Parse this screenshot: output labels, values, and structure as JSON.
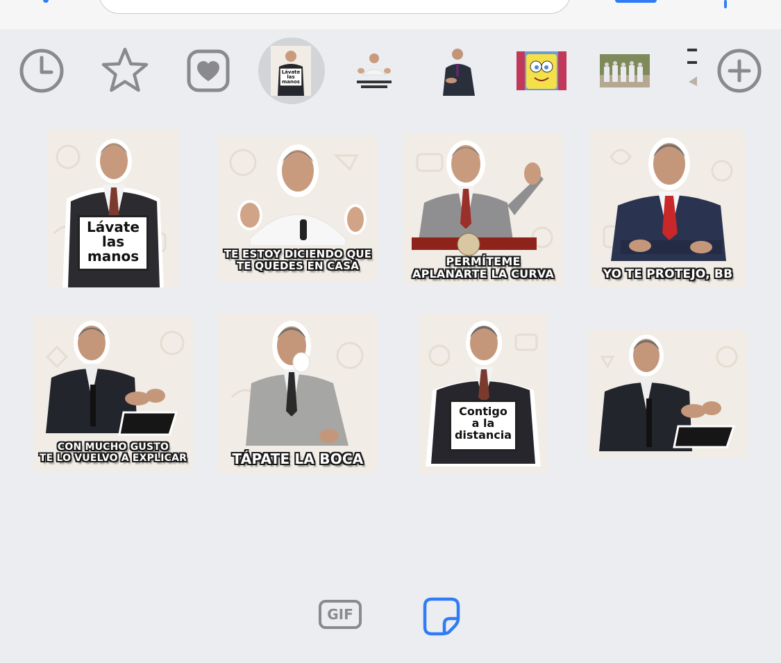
{
  "top": {
    "input_placeholder": ""
  },
  "tray": {
    "items": [
      {
        "name": "recent",
        "icon": "clock-icon"
      },
      {
        "name": "favorites",
        "icon": "star-icon"
      },
      {
        "name": "love-pack",
        "icon": "heart-icon"
      },
      {
        "name": "pack-lavate-las-manos",
        "label": "Lávate las manos",
        "selected": true
      },
      {
        "name": "pack-te-estoy-diciendo",
        "label": "TE ESTOY DICIENDO QUE TE QUEDES EN CASA"
      },
      {
        "name": "pack-man-standing"
      },
      {
        "name": "pack-spongebob"
      },
      {
        "name": "pack-group"
      },
      {
        "name": "pack-partial"
      },
      {
        "name": "add",
        "icon": "plus-circle-icon"
      }
    ]
  },
  "stickers": [
    {
      "id": 1,
      "sign": [
        "Lávate",
        "las",
        "manos"
      ],
      "caption": ""
    },
    {
      "id": 2,
      "sign": [],
      "caption": "TE ESTOY DICIENDO QUE\nTE QUEDES EN CASA"
    },
    {
      "id": 3,
      "sign": [],
      "caption": "PERMÍTEME\nAPLANARTE LA CURVA"
    },
    {
      "id": 4,
      "sign": [],
      "caption": "YO TE PROTEJO, BB"
    },
    {
      "id": 5,
      "sign": [],
      "caption": "CON MUCHO GUSTO\nTE LO VUELVO A EXPLICAR"
    },
    {
      "id": 6,
      "sign": [],
      "caption": "TÁPATE LA BOCA"
    },
    {
      "id": 7,
      "sign": [
        "Contigo",
        "a la",
        "distancia"
      ],
      "caption": ""
    },
    {
      "id": 8,
      "sign": [],
      "caption": ""
    }
  ],
  "bottom": {
    "gif_label": "GIF",
    "active_tab": "stickers"
  },
  "colors": {
    "accent": "#2f7cf6",
    "icon_gray": "#8a8a8e",
    "background": "#ebedf1",
    "sticker_bg": "#f1ece5"
  }
}
